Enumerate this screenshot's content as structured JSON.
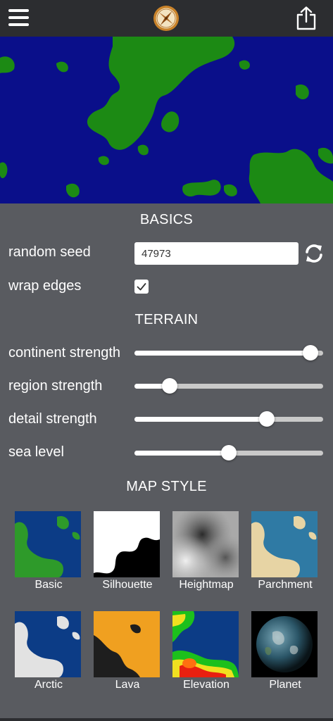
{
  "topbar": {
    "menu_icon": "hamburger-menu-icon",
    "logo_icon": "compass-icon",
    "share_icon": "share-icon"
  },
  "map_preview": {
    "icon": "map-preview",
    "water_color": "#0a0f8a",
    "land_color": "#1c8a14"
  },
  "basics": {
    "title": "BASICS",
    "seed_label": "random seed",
    "seed_value": "47973",
    "refresh_icon": "refresh-icon",
    "wrap_label": "wrap edges",
    "wrap_checked": true
  },
  "terrain": {
    "title": "TERRAIN",
    "sliders": [
      {
        "label": "continent strength",
        "value": 0.97
      },
      {
        "label": "region strength",
        "value": 0.16
      },
      {
        "label": "detail strength",
        "value": 0.72
      },
      {
        "label": "sea level",
        "value": 0.5
      }
    ]
  },
  "map_style": {
    "title": "MAP STYLE",
    "styles": [
      {
        "label": "Basic",
        "icon": "basic-style-thumbnail"
      },
      {
        "label": "Silhouette",
        "icon": "silhouette-style-thumbnail"
      },
      {
        "label": "Heightmap",
        "icon": "heightmap-style-thumbnail"
      },
      {
        "label": "Parchment",
        "icon": "parchment-style-thumbnail"
      },
      {
        "label": "Arctic",
        "icon": "arctic-style-thumbnail"
      },
      {
        "label": "Lava",
        "icon": "lava-style-thumbnail"
      },
      {
        "label": "Elevation",
        "icon": "elevation-style-thumbnail"
      },
      {
        "label": "Planet",
        "icon": "planet-style-thumbnail"
      }
    ]
  }
}
